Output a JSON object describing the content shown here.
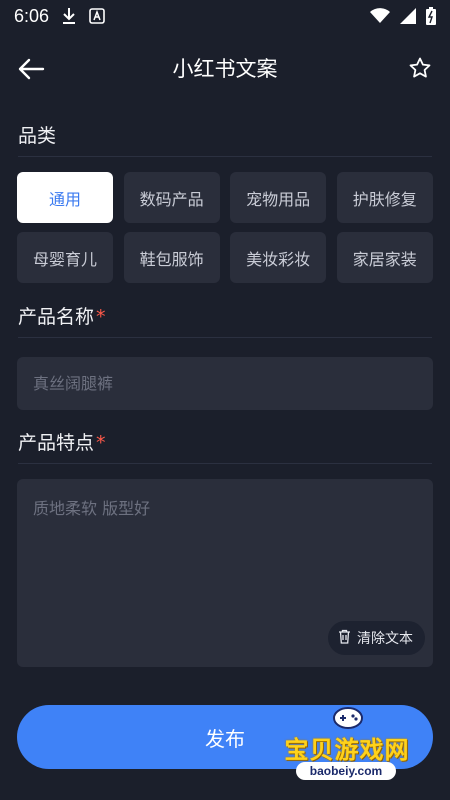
{
  "status_bar": {
    "time": "6:06"
  },
  "header": {
    "title": "小红书文案"
  },
  "category": {
    "label": "品类",
    "items": [
      {
        "label": "通用",
        "selected": true
      },
      {
        "label": "数码产品",
        "selected": false
      },
      {
        "label": "宠物用品",
        "selected": false
      },
      {
        "label": "护肤修复",
        "selected": false
      },
      {
        "label": "母婴育儿",
        "selected": false
      },
      {
        "label": "鞋包服饰",
        "selected": false
      },
      {
        "label": "美妆彩妆",
        "selected": false
      },
      {
        "label": "家居家装",
        "selected": false
      }
    ]
  },
  "product_name": {
    "label": "产品名称",
    "required_mark": "*",
    "value": "",
    "placeholder": "真丝阔腿裤"
  },
  "product_features": {
    "label": "产品特点",
    "required_mark": "*",
    "value": "",
    "placeholder": "质地柔软 版型好",
    "clear_label": "清除文本"
  },
  "publish": {
    "label": "发布"
  },
  "watermark": {
    "text": "宝贝游戏网",
    "url": "baobeiy.com"
  },
  "colors": {
    "background": "#1b1f2b",
    "accent": "#3f82f7",
    "chip": "#2a2e3b",
    "required": "#ff5a4a"
  },
  "icons": [
    "download-icon",
    "a-icon",
    "wifi-icon",
    "cellular-icon",
    "battery-icon",
    "back-arrow-icon",
    "star-icon",
    "trash-icon"
  ]
}
